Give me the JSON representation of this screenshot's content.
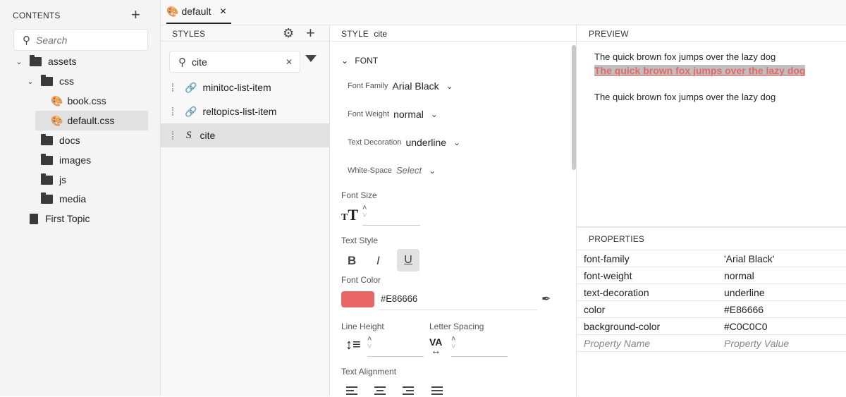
{
  "contents": {
    "title": "CONTENTS",
    "search_placeholder": "Search",
    "tree": [
      {
        "label": "assets"
      },
      {
        "label": "css"
      },
      {
        "label": "book.css"
      },
      {
        "label": "default.css"
      },
      {
        "label": "docs"
      },
      {
        "label": "images"
      },
      {
        "label": "js"
      },
      {
        "label": "media"
      },
      {
        "label": "First Topic"
      }
    ]
  },
  "tab": {
    "label": "default",
    "close": "✕"
  },
  "styles": {
    "title": "STYLES",
    "search_value": "cite",
    "items": [
      {
        "label": "minitoc-list-item",
        "icon": "link-icon"
      },
      {
        "label": "reltopics-list-item",
        "icon": "link-icon"
      },
      {
        "label": "cite",
        "icon": "style-icon"
      }
    ]
  },
  "editor": {
    "style_label": "STYLE",
    "style_name": "cite",
    "font_section": "FONT",
    "font_family_label": "Font Family",
    "font_family": "Arial Black",
    "font_weight_label": "Font Weight",
    "font_weight": "normal",
    "text_decoration_label": "Text Decoration",
    "text_decoration": "underline",
    "white_space_label": "White-Space",
    "white_space_placeholder": "Select",
    "font_size_label": "Font Size",
    "text_style_label": "Text Style",
    "bold": "B",
    "italic": "I",
    "underline": "U",
    "font_color_label": "Font Color",
    "font_color": "#E86666",
    "line_height_label": "Line Height",
    "letter_spacing_label": "Letter Spacing",
    "text_alignment_label": "Text Alignment"
  },
  "preview": {
    "title": "PREVIEW",
    "line1": "The quick brown fox jumps over the lazy dog",
    "line2": "The quick brown fox jumps over the lazy dog",
    "line3": "The quick brown fox jumps over the lazy dog",
    "highlight_bg": "#C0C0C0"
  },
  "properties": {
    "title": "PROPERTIES",
    "rows": [
      {
        "name": "font-family",
        "value": "'Arial Black'"
      },
      {
        "name": "font-weight",
        "value": "normal"
      },
      {
        "name": "text-decoration",
        "value": "underline"
      },
      {
        "name": "color",
        "value": "#E86666"
      },
      {
        "name": "background-color",
        "value": "#C0C0C0"
      }
    ],
    "name_placeholder": "Property Name",
    "value_placeholder": "Property Value"
  }
}
